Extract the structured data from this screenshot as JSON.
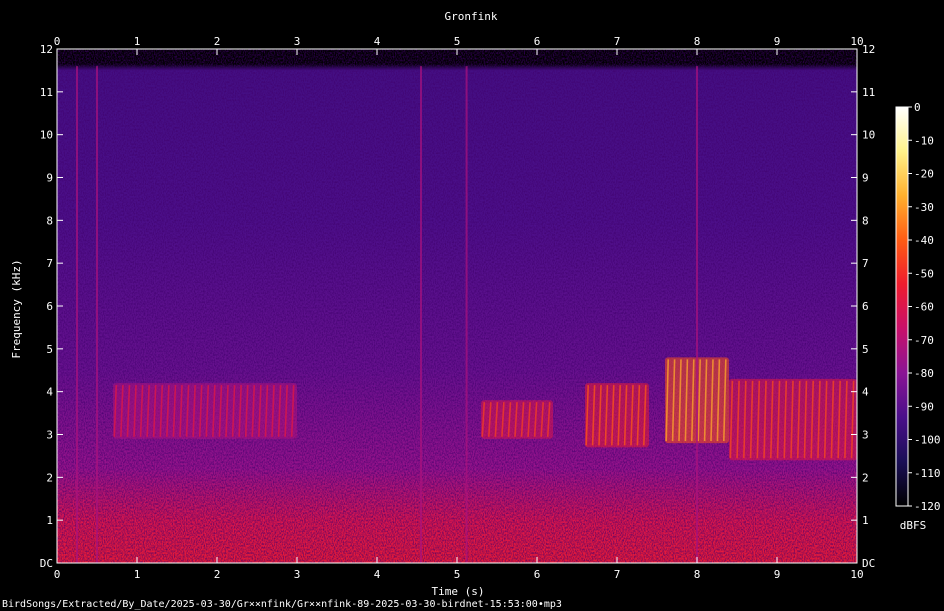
{
  "chart_data": {
    "type": "heatmap",
    "title": "Gronfink",
    "xlabel": "Time (s)",
    "ylabel": "Frequency (kHz)",
    "xlim": [
      0,
      10
    ],
    "ylim": [
      0,
      12
    ],
    "x_ticks": [
      0,
      1,
      2,
      3,
      4,
      5,
      6,
      7,
      8,
      9,
      10
    ],
    "y_ticks": [
      {
        "value": 0,
        "label": "DC"
      },
      {
        "value": 1,
        "label": "1"
      },
      {
        "value": 2,
        "label": "2"
      },
      {
        "value": 3,
        "label": "3"
      },
      {
        "value": 4,
        "label": "4"
      },
      {
        "value": 5,
        "label": "5"
      },
      {
        "value": 6,
        "label": "6"
      },
      {
        "value": 7,
        "label": "7"
      },
      {
        "value": 8,
        "label": "8"
      },
      {
        "value": 9,
        "label": "9"
      },
      {
        "value": 10,
        "label": "10"
      },
      {
        "value": 11,
        "label": "11"
      },
      {
        "value": 12,
        "label": "12"
      }
    ],
    "colorbar": {
      "label": "dBFS",
      "range": [
        -120,
        0
      ],
      "ticks": [
        0,
        -10,
        -20,
        -30,
        -40,
        -50,
        -60,
        -70,
        -80,
        -90,
        -100,
        -110,
        -120
      ],
      "colors": [
        "#000000",
        "#1a0f56",
        "#4a0f8a",
        "#8a1494",
        "#c8106a",
        "#ee1c2e",
        "#ff5c14",
        "#ffb02e",
        "#fff28a",
        "#ffffff"
      ]
    },
    "noise_floor_db": -95,
    "low_band": {
      "from_khz": 0,
      "to_khz": 2.2,
      "peak_db": -55
    },
    "transients_s": [
      0.25,
      0.5,
      4.55,
      5.12,
      8.0
    ],
    "song_events": [
      {
        "t0": 5.3,
        "t1": 6.2,
        "f0": 2.9,
        "f1": 3.8,
        "db": -60
      },
      {
        "t0": 6.6,
        "t1": 7.4,
        "f0": 2.7,
        "f1": 4.2,
        "db": -55
      },
      {
        "t0": 7.6,
        "t1": 8.4,
        "f0": 2.8,
        "f1": 4.8,
        "db": -42
      },
      {
        "t0": 8.4,
        "t1": 10.0,
        "f0": 2.4,
        "f1": 4.3,
        "db": -58
      },
      {
        "t0": 0.7,
        "t1": 3.0,
        "f0": 2.9,
        "f1": 4.2,
        "db": -72
      }
    ],
    "footer_path": "BirdSongs/Extracted/By_Date/2025-03-30/Gr××nfink/Gr××nfink-89-2025-03-30-birdnet-15:53:00•mp3"
  }
}
